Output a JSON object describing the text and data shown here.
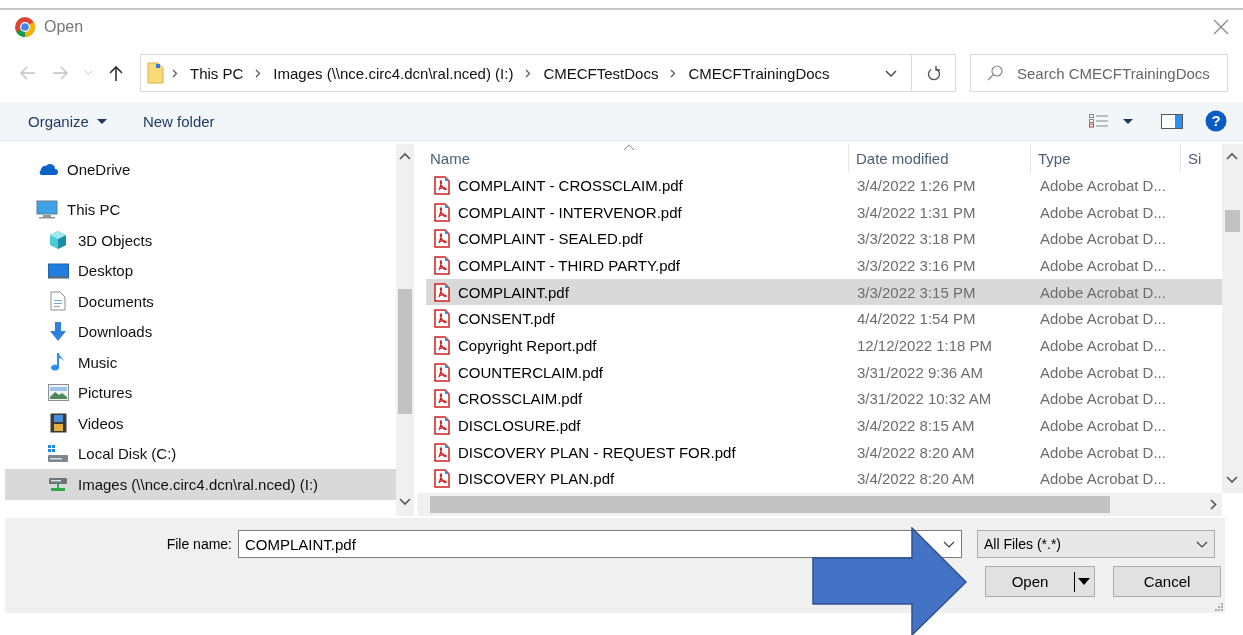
{
  "window": {
    "title": "Open"
  },
  "address": {
    "crumbs": [
      "This PC",
      "Images (\\\\nce.circ4.dcn\\ral.nced) (I:)",
      "CMECFTestDocs",
      "CMECFTrainingDocs"
    ]
  },
  "search": {
    "placeholder": "Search CMECFTrainingDocs"
  },
  "toolbar": [
    {
      "label": "Organize",
      "kind": "menu"
    },
    {
      "label": "New folder",
      "kind": "plain"
    }
  ],
  "help": {
    "glyph": "?"
  },
  "nav": [
    {
      "label": "OneDrive",
      "kind": "cloud",
      "selected": false
    },
    {
      "label": "This PC",
      "kind": "computer",
      "selected": false,
      "children": [
        {
          "label": "3D Objects",
          "kind": "cube",
          "selected": false
        },
        {
          "label": "Desktop",
          "kind": "desktop",
          "selected": false
        },
        {
          "label": "Documents",
          "kind": "document",
          "selected": false
        },
        {
          "label": "Downloads",
          "kind": "download",
          "selected": false
        },
        {
          "label": "Music",
          "kind": "music",
          "selected": false
        },
        {
          "label": "Pictures",
          "kind": "picture",
          "selected": false
        },
        {
          "label": "Videos",
          "kind": "video",
          "selected": false
        },
        {
          "label": "Local Disk (C:)",
          "kind": "disk",
          "selected": false
        },
        {
          "label": "Images (\\\\nce.circ4.dcn\\ral.nced) (I:)",
          "kind": "netdrive",
          "selected": true
        }
      ]
    }
  ],
  "files": {
    "columns": [
      "Name",
      "Date modified",
      "Type",
      "Si"
    ],
    "rows": [
      {
        "name": "COMPLAINT - CROSSCLAIM.pdf",
        "date": "3/4/2022 1:26 PM",
        "type": "Adobe Acrobat D...",
        "selected": false
      },
      {
        "name": "COMPLAINT - INTERVENOR.pdf",
        "date": "3/4/2022 1:31 PM",
        "type": "Adobe Acrobat D...",
        "selected": false
      },
      {
        "name": "COMPLAINT - SEALED.pdf",
        "date": "3/3/2022 3:18 PM",
        "type": "Adobe Acrobat D...",
        "selected": false
      },
      {
        "name": "COMPLAINT - THIRD PARTY.pdf",
        "date": "3/3/2022 3:16 PM",
        "type": "Adobe Acrobat D...",
        "selected": false
      },
      {
        "name": "COMPLAINT.pdf",
        "date": "3/3/2022 3:15 PM",
        "type": "Adobe Acrobat D...",
        "selected": true
      },
      {
        "name": "CONSENT.pdf",
        "date": "4/4/2022 1:54 PM",
        "type": "Adobe Acrobat D...",
        "selected": false
      },
      {
        "name": "Copyright Report.pdf",
        "date": "12/12/2022 1:18 PM",
        "type": "Adobe Acrobat D...",
        "selected": false
      },
      {
        "name": "COUNTERCLAIM.pdf",
        "date": "3/31/2022 9:36 AM",
        "type": "Adobe Acrobat D...",
        "selected": false
      },
      {
        "name": "CROSSCLAIM.pdf",
        "date": "3/31/2022 10:32 AM",
        "type": "Adobe Acrobat D...",
        "selected": false
      },
      {
        "name": "DISCLOSURE.pdf",
        "date": "3/4/2022 8:15 AM",
        "type": "Adobe Acrobat D...",
        "selected": false
      },
      {
        "name": "DISCOVERY PLAN - REQUEST FOR.pdf",
        "date": "3/4/2022 8:20 AM",
        "type": "Adobe Acrobat D...",
        "selected": false
      },
      {
        "name": "DISCOVERY PLAN.pdf",
        "date": "3/4/2022 8:20 AM",
        "type": "Adobe Acrobat D...",
        "selected": false
      }
    ]
  },
  "file_name": {
    "label": "File name:",
    "value": "COMPLAINT.pdf"
  },
  "file_type": {
    "value": "All Files (*.*)"
  },
  "buttons": [
    {
      "label": "Open",
      "kind": "split"
    },
    {
      "label": "Cancel",
      "kind": "plain"
    }
  ]
}
